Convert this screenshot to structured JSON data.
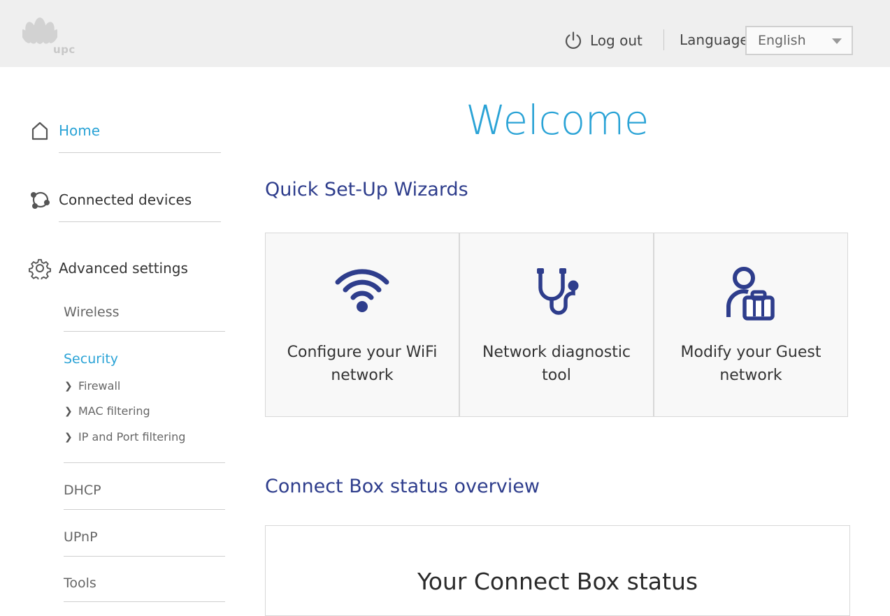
{
  "header": {
    "logo_text": "upc",
    "logout_label": "Log out",
    "language_label": "Language",
    "language_selected": "English",
    "colors": {
      "bar": "#efefef",
      "accent": "#2aa3d6",
      "navy": "#2e3d8c"
    }
  },
  "sidebar": {
    "main_items": [
      {
        "label": "Home",
        "icon": "home-icon",
        "active": true
      },
      {
        "label": "Connected devices",
        "icon": "connected-devices-icon",
        "active": false
      },
      {
        "label": "Advanced settings",
        "icon": "gear-icon",
        "active": false
      }
    ],
    "sub_items": [
      {
        "label": "Wireless"
      },
      {
        "label": "Security",
        "active": true
      },
      {
        "label": "DHCP"
      },
      {
        "label": "UPnP"
      },
      {
        "label": "Tools"
      }
    ],
    "security_items": [
      {
        "label": "Firewall"
      },
      {
        "label": "MAC filtering"
      },
      {
        "label": "IP and Port filtering"
      }
    ]
  },
  "main": {
    "welcome": "Welcome",
    "wizards_title": "Quick Set-Up Wizards",
    "wizards": [
      {
        "label": "Configure your WiFi network",
        "icon": "wifi-icon"
      },
      {
        "label": "Network diagnostic tool",
        "icon": "stethoscope-icon"
      },
      {
        "label": "Modify your Guest network",
        "icon": "guest-user-icon"
      }
    ],
    "status_title": "Connect Box status overview",
    "status_box_title": "Your Connect Box status"
  }
}
